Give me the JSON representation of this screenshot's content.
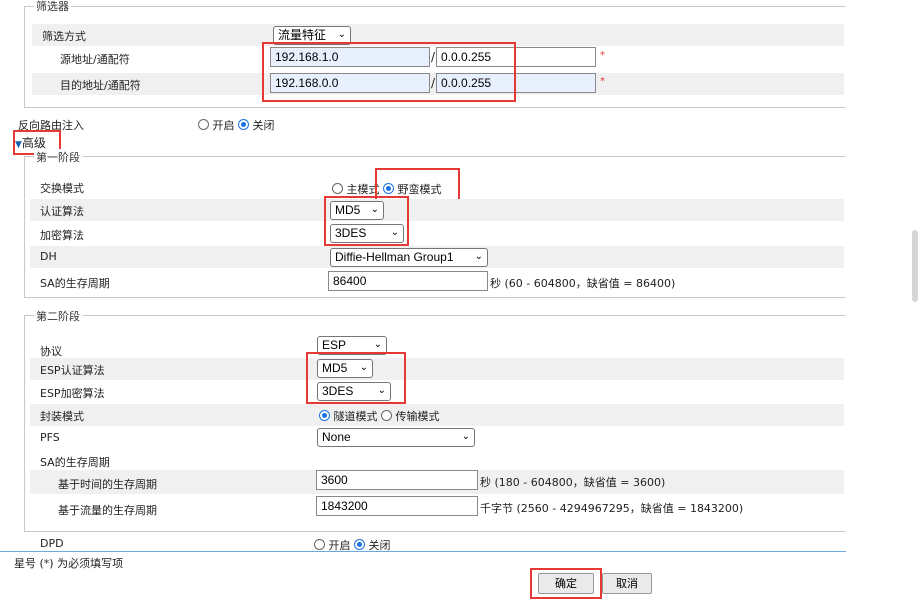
{
  "filter": {
    "legend": "筛选器",
    "method_label": "筛选方式",
    "method_value": "流量特征",
    "src_label": "源地址/通配符",
    "src_ip": "192.168.1.0",
    "src_mask": "0.0.0.255",
    "dst_label": "目的地址/通配符",
    "dst_ip": "192.168.0.0",
    "dst_mask": "0.0.0.255",
    "required_star": "*",
    "slash": "/"
  },
  "reverse_route": {
    "label": "反向路由注入",
    "on_label": "开启",
    "off_label": "关闭",
    "selected": "off"
  },
  "advanced": {
    "toggle_label": "高级",
    "toggle_arrow": "▼"
  },
  "phase1": {
    "legend": "第一阶段",
    "exchange_label": "交换模式",
    "main_mode_label": "主模式",
    "aggressive_label": "野蛮模式",
    "selected_mode": "aggressive",
    "auth_label": "认证算法",
    "auth_value": "MD5",
    "enc_label": "加密算法",
    "enc_value": "3DES",
    "dh_label": "DH",
    "dh_value": "Diffie-Hellman Group1",
    "sa_label": "SA的生存周期",
    "sa_value": "86400",
    "sa_hint": "秒 (60 - 604800，缺省值 = 86400)"
  },
  "phase2": {
    "legend": "第二阶段",
    "protocol_label": "协议",
    "protocol_value": "ESP",
    "esp_auth_label": "ESP认证算法",
    "esp_auth_value": "MD5",
    "esp_enc_label": "ESP加密算法",
    "esp_enc_value": "3DES",
    "encap_label": "封装模式",
    "tunnel_label": "隧道模式",
    "transport_label": "传输模式",
    "selected_encap": "tunnel",
    "pfs_label": "PFS",
    "pfs_value": "None",
    "sa_label": "SA的生存周期",
    "time_label": "基于时间的生存周期",
    "time_value": "3600",
    "time_hint": "秒 (180 - 604800，缺省值 = 3600)",
    "traffic_label": "基于流量的生存周期",
    "traffic_value": "1843200",
    "traffic_hint": "千字节 (2560 - 4294967295，缺省值 = 1843200)"
  },
  "dpd": {
    "label": "DPD",
    "on_label": "开启",
    "off_label": "关闭",
    "selected": "off"
  },
  "footer": {
    "required_note": "星号 (*) 为必须填写项",
    "ok_label": "确定",
    "cancel_label": "取消"
  },
  "colors": {
    "highlight": "#e53935",
    "radio_selected": "#1a73e8",
    "row_shade": "#f0f0f0",
    "input_autofill": "#e8f0fe"
  }
}
